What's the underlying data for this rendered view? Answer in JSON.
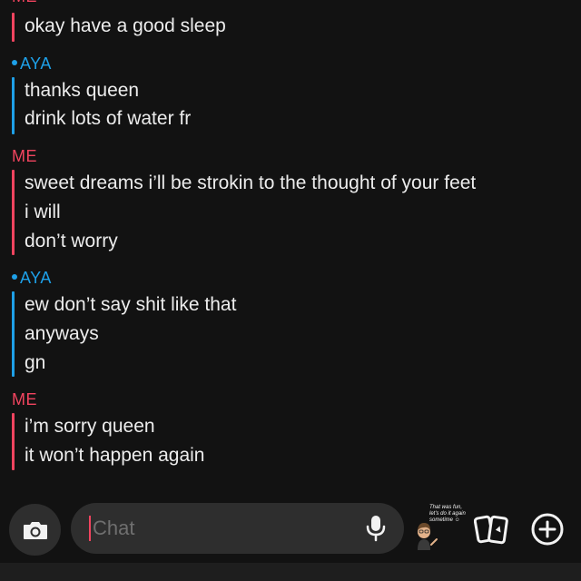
{
  "conversation": {
    "top_sender": "ME",
    "top_message": "okay have a good sleep",
    "groups": [
      {
        "sender": "AYA",
        "messages": [
          "thanks queen",
          "drink lots of water fr"
        ]
      },
      {
        "sender": "ME",
        "messages": [
          "sweet dreams i’ll be strokin to the thought of your feet",
          "i will",
          "don’t worry"
        ]
      },
      {
        "sender": "AYA",
        "messages": [
          "ew don’t say shit like that",
          "anyways",
          "gn"
        ]
      },
      {
        "sender": "ME",
        "messages": [
          "i’m sorry queen",
          "it won’t happen again"
        ]
      }
    ]
  },
  "composer": {
    "placeholder": "Chat",
    "bitmoji_caption": [
      "That was fun,",
      "let's do it again",
      "sometime ☺"
    ]
  },
  "colors": {
    "me_accent": "#f1445f",
    "friend_accent": "#1ea0e8",
    "background": "#121212",
    "input_background": "#2e2e2e",
    "message_text": "#ececec"
  },
  "icons": {
    "camera": "camera-icon",
    "mic": "microphone-icon",
    "bitmoji": "bitmoji-sticker-icon",
    "cards": "cards-icon",
    "plus": "plus-circle-icon"
  }
}
